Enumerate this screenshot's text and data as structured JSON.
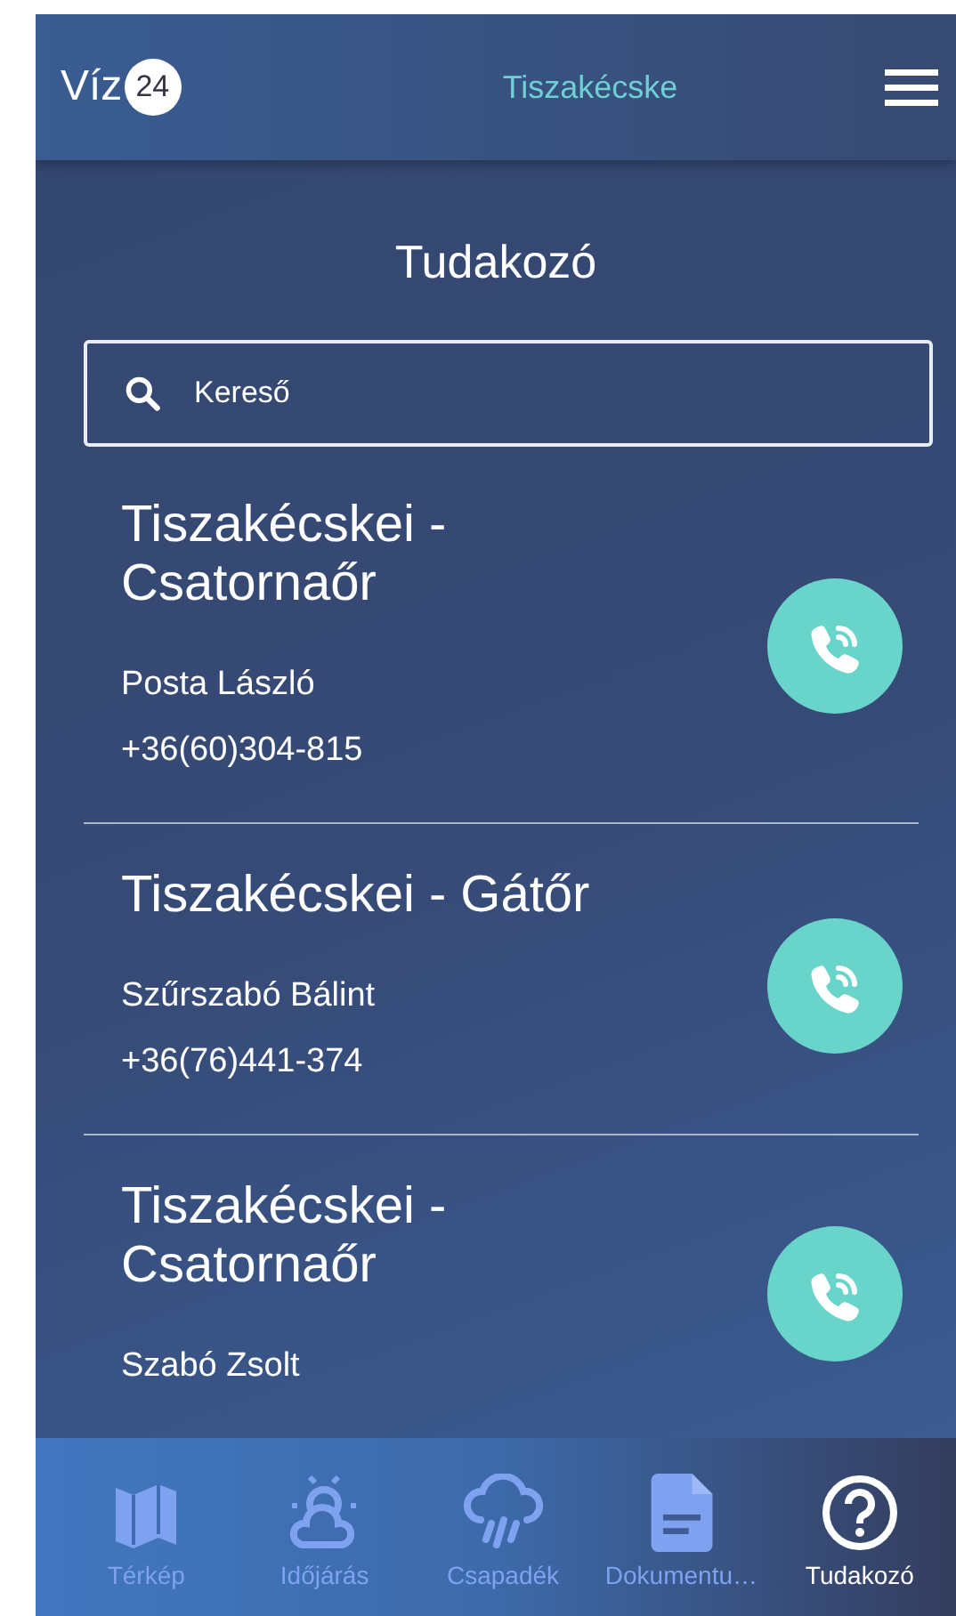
{
  "header": {
    "logo_text": "Víz",
    "logo_badge": "24",
    "location": "Tiszakécske"
  },
  "page_title": "Tudakozó",
  "search": {
    "placeholder": "Kereső"
  },
  "contacts": [
    {
      "title": "Tiszakécskei - Csatornaőr",
      "name": "Posta László",
      "phone": "+36(60)304-815"
    },
    {
      "title": "Tiszakécskei - Gátőr",
      "name": "Szűrszabó Bálint",
      "phone": "+36(76)441-374"
    },
    {
      "title": "Tiszakécskei - Csatornaőr",
      "name": "Szabó Zsolt"
    }
  ],
  "nav": [
    {
      "label": "Térkép",
      "kind": "map",
      "selected": false
    },
    {
      "label": "Időjárás",
      "kind": "weather",
      "selected": false
    },
    {
      "label": "Csapadék",
      "kind": "rain",
      "selected": false
    },
    {
      "label": "Dokumentu…",
      "kind": "document",
      "selected": false
    },
    {
      "label": "Tudakozó",
      "kind": "help",
      "selected": true
    }
  ]
}
